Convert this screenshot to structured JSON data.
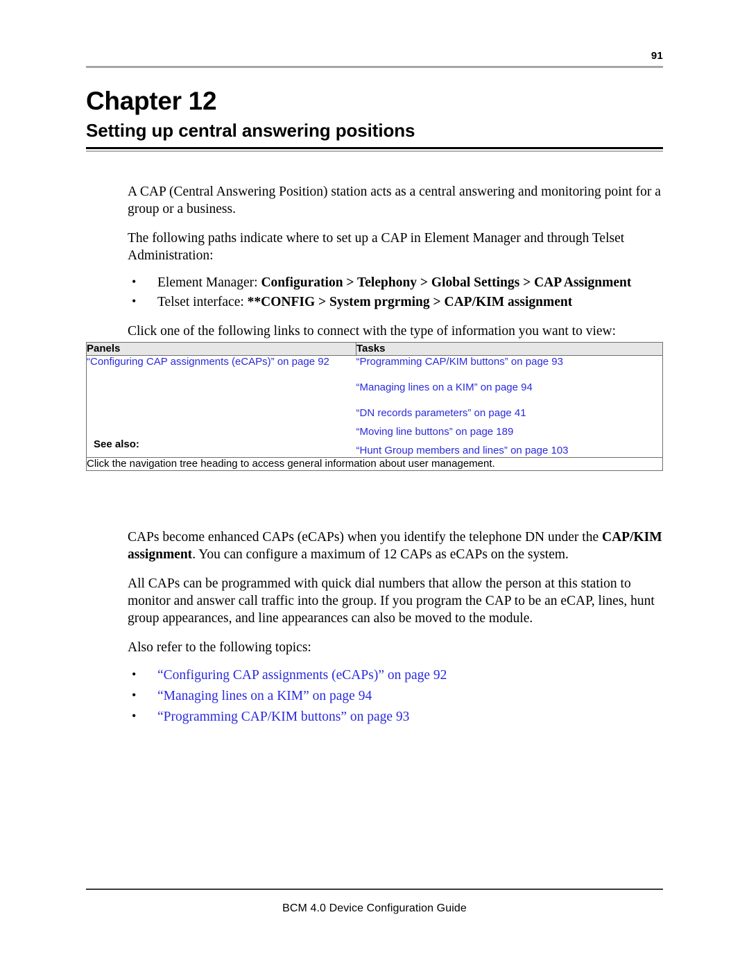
{
  "header": {
    "folio": "91"
  },
  "title": {
    "chapter_label": "Chapter 12",
    "chapter_title": "Setting up central answering positions"
  },
  "intro": {
    "para1": "A CAP (Central Answering Position) station acts as a central answering and monitoring point for a group or a business.",
    "para2": "The following paths indicate where to set up a CAP in Element Manager and through Telset Administration:",
    "paths": [
      {
        "prefix": "Element Manager: ",
        "path": "Configuration > Telephony > Global Settings > CAP Assignment"
      },
      {
        "prefix": "Telset interface: ",
        "path": "**CONFIG > System prgrming > CAP/KIM assignment"
      }
    ],
    "para3": "Click one of the following links to connect with the type of information you want to view:"
  },
  "table": {
    "headers": {
      "panels": "Panels",
      "tasks": "Tasks"
    },
    "panels_links": [
      "“Configuring CAP assignments (eCAPs)” on page 92"
    ],
    "tasks_links": [
      "“Programming CAP/KIM buttons” on page 93",
      "“Managing lines on a KIM” on page 94",
      "“DN records parameters” on page 41",
      "“Moving line buttons” on page 189",
      "“Hunt Group members and lines” on page 103"
    ],
    "see_also_label": "See also:",
    "footer_note": "Click the navigation tree heading to access general information about user management."
  },
  "body": {
    "para4_a": "CAPs become enhanced CAPs (eCAPs) when you identify the telephone DN under the ",
    "para4_bold": "CAP/KIM assignment",
    "para4_b": ". You can configure a maximum of 12 CAPs as eCAPs on the system.",
    "para5": "All CAPs can be programmed with quick dial numbers that allow the person at this station to monitor and answer call traffic into the group. If you program the CAP to be an eCAP, lines, hunt group appearances, and line appearances can also be moved to the module.",
    "para6": "Also refer to the following topics:",
    "topic_links": [
      "“Configuring CAP assignments (eCAPs)” on page 92",
      "“Managing lines on a KIM” on page 94",
      "“Programming CAP/KIM buttons” on page 93"
    ]
  },
  "footer": {
    "text": "BCM 4.0 Device Configuration Guide"
  },
  "colors": {
    "link_blue": "#2a2add",
    "table_header_bg": "#e6e6e6",
    "rule_gray": "#a6a6a6"
  }
}
